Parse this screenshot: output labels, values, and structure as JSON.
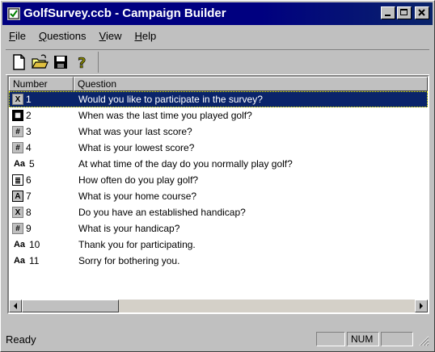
{
  "window": {
    "title": "GolfSurvey.ccb - Campaign Builder"
  },
  "menubar": {
    "items": [
      {
        "key": "F",
        "rest": "ile"
      },
      {
        "key": "Q",
        "rest": "uestions"
      },
      {
        "key": "V",
        "rest": "iew"
      },
      {
        "key": "H",
        "rest": "elp"
      }
    ]
  },
  "toolbar": {
    "icons": [
      "new-document-icon",
      "open-folder-icon",
      "save-disk-icon",
      "help-question-icon"
    ]
  },
  "list": {
    "columns": [
      "Number",
      "Question"
    ],
    "rows": [
      {
        "type": "x",
        "num": "1",
        "question": "Would you like to participate in the survey?",
        "selected": true
      },
      {
        "type": "cal",
        "num": "2",
        "question": "When was the last time you played golf?"
      },
      {
        "type": "hash",
        "num": "3",
        "question": "What was your last score?"
      },
      {
        "type": "hash",
        "num": "4",
        "question": "What is your lowest score?"
      },
      {
        "type": "aa",
        "num": "5",
        "question": "At what time of the day do you normally play golf?"
      },
      {
        "type": "list",
        "num": "6",
        "question": "How often do you play golf?"
      },
      {
        "type": "a",
        "num": "7",
        "question": "What is your home course?"
      },
      {
        "type": "x",
        "num": "8",
        "question": "Do you have an established handicap?"
      },
      {
        "type": "hash",
        "num": "9",
        "question": "What is your handicap?"
      },
      {
        "type": "aa",
        "num": "10",
        "question": "Thank you for participating."
      },
      {
        "type": "aa",
        "num": "11",
        "question": "Sorry for bothering you."
      }
    ]
  },
  "statusbar": {
    "text": "Ready",
    "num": "NUM"
  }
}
